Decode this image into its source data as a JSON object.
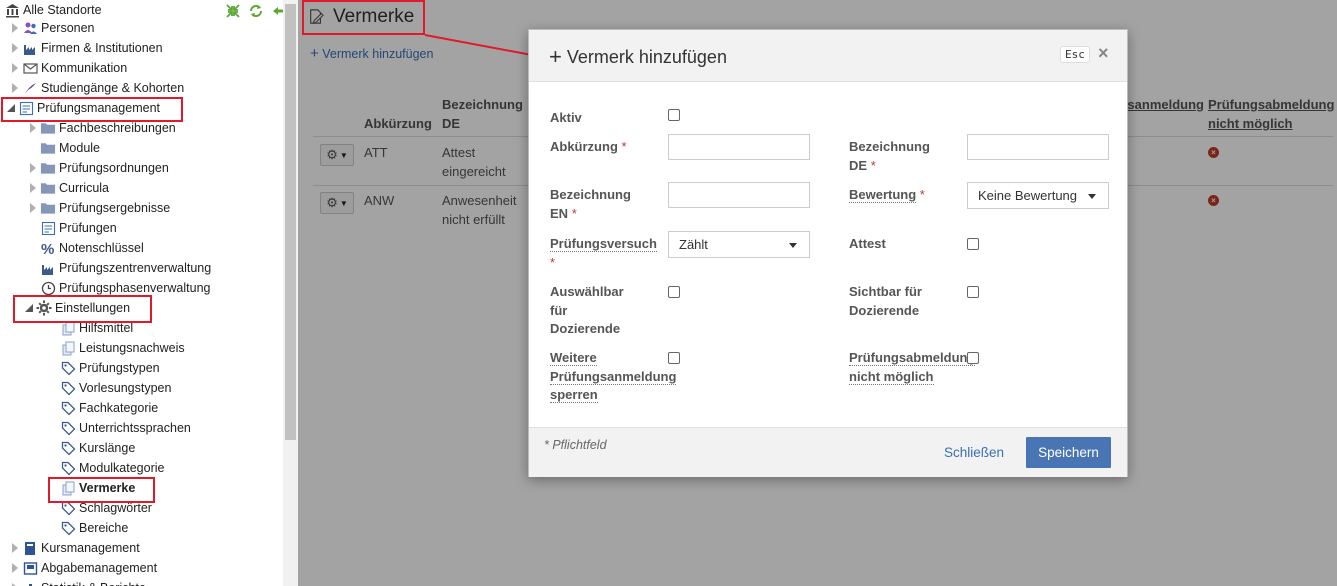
{
  "sidebar": {
    "root": "Alle Standorte",
    "items": [
      {
        "label": "Personen",
        "icon": "persons-icon"
      },
      {
        "label": "Firmen & Institutionen",
        "icon": "factory-icon"
      },
      {
        "label": "Kommunikation",
        "icon": "envelope-icon"
      },
      {
        "label": "Studiengänge & Kohorten",
        "icon": "graduation-icon"
      },
      {
        "label": "Prüfungsmanagement",
        "icon": "checklist-icon"
      },
      {
        "label": "Fachbeschreibungen",
        "icon": "folder-icon"
      },
      {
        "label": "Module",
        "icon": "folder-icon"
      },
      {
        "label": "Prüfungsordnungen",
        "icon": "folder-icon"
      },
      {
        "label": "Curricula",
        "icon": "folder-icon"
      },
      {
        "label": "Prüfungsergebnisse",
        "icon": "folder-icon"
      },
      {
        "label": "Prüfungen",
        "icon": "checklist-icon"
      },
      {
        "label": "Notenschlüssel",
        "icon": "percent-icon"
      },
      {
        "label": "Prüfungszentrenverwaltung",
        "icon": "factory-icon"
      },
      {
        "label": "Prüfungsphasenverwaltung",
        "icon": "clock-icon"
      },
      {
        "label": "Einstellungen",
        "icon": "gear-icon"
      },
      {
        "label": "Hilfsmittel",
        "icon": "copy-icon"
      },
      {
        "label": "Leistungsnachweis",
        "icon": "copy-icon"
      },
      {
        "label": "Prüfungstypen",
        "icon": "tag-icon"
      },
      {
        "label": "Vorlesungstypen",
        "icon": "tag-icon"
      },
      {
        "label": "Fachkategorie",
        "icon": "tag-icon"
      },
      {
        "label": "Unterrichtssprachen",
        "icon": "tag-icon"
      },
      {
        "label": "Kurslänge",
        "icon": "tag-icon"
      },
      {
        "label": "Modulkategorie",
        "icon": "tag-icon"
      },
      {
        "label": "Vermerke",
        "icon": "copy-icon"
      },
      {
        "label": "Schlagwörter",
        "icon": "tag-icon"
      },
      {
        "label": "Bereiche",
        "icon": "tag-icon"
      },
      {
        "label": "Kursmanagement",
        "icon": "book-icon"
      },
      {
        "label": "Abgabemanagement",
        "icon": "inbox-icon"
      },
      {
        "label": "Statistik & Berichte",
        "icon": "chart-icon"
      }
    ]
  },
  "main": {
    "title": "Vermerke",
    "add_link": "Vermerk hinzufügen",
    "columns": [
      "Abkürzung",
      "Bezeichnung DE",
      "Prüfungsanmeldung",
      "Prüfungsabmeldung nicht möglich"
    ],
    "rows": [
      {
        "abk": "ATT",
        "bez": "Attest eingereicht"
      },
      {
        "abk": "ANW",
        "bez": "Anwesenheit nicht erfüllt"
      }
    ]
  },
  "modal": {
    "title": "Vermerk hinzufügen",
    "esc": "Esc",
    "fields": {
      "aktiv": "Aktiv",
      "abk": "Abkürzung",
      "bez_de": "Bezeichnung DE",
      "bez_en": "Bezeichnung EN",
      "bewertung": "Bewertung",
      "bewertung_value": "Keine Bewertung",
      "versuch": "Prüfungsversuch",
      "versuch_value": "Zählt",
      "attest": "Attest",
      "auswaehlbar": "Auswählbar für Dozierende",
      "sichtbar": "Sichtbar für Dozierende",
      "weitere": "Weitere Prüfungsanmeldung sperren",
      "abmeldung": "Prüfungsabmeldung nicht möglich"
    },
    "required_marker": "*",
    "pflichtfeld": "* Pflichtfeld",
    "close_label": "Schließen",
    "save_label": "Speichern"
  },
  "colors": {
    "highlight": "#e0192b",
    "primary": "#4a75b5",
    "link": "#3a6fb5"
  }
}
